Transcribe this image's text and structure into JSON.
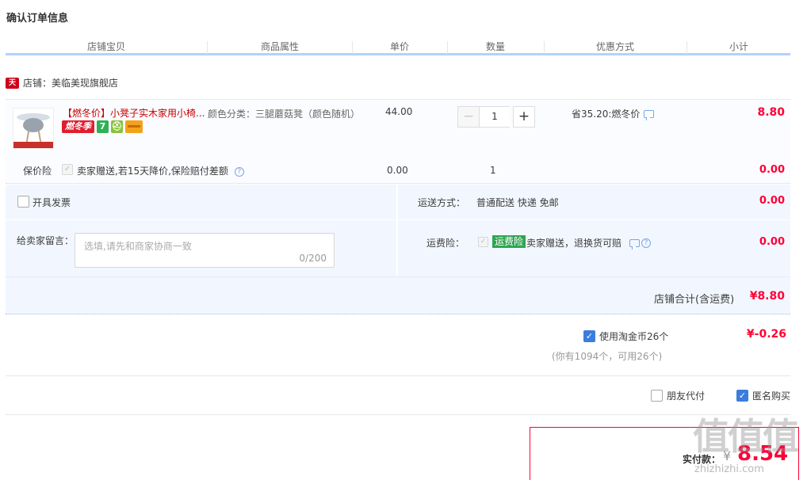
{
  "page_title": "确认订单信息",
  "columns": [
    "店铺宝贝",
    "商品属性",
    "单价",
    "数量",
    "优惠方式",
    "小计"
  ],
  "shop": {
    "badge": "天猫",
    "name": "店铺：美临美现旗舰店"
  },
  "item": {
    "thumb_caption": "三腿蘑菇凳",
    "title": "【燃冬价】小凳子实木家用小椅...",
    "promo_tag": "燃冬季",
    "promo_icons": [
      "7",
      "⛑"
    ],
    "attr": "颜色分类：三腿蘑菇凳（颜色随机）",
    "unit_price": "44.00",
    "quantity": "1",
    "minus_label": "−",
    "plus_label": "+",
    "discount": "省35.20:燃冬价",
    "subtotal": "8.80"
  },
  "insurance": {
    "label": "保价险",
    "check_mark": "✓",
    "text": "卖家赠送,若15天降价,保险赔付差额",
    "help": "?",
    "price": "0.00",
    "qty": "1",
    "subtotal": "0.00"
  },
  "invoice": {
    "label": "开具发票"
  },
  "shipping": {
    "label": "运送方式：",
    "value": "普通配送 快递 免邮",
    "fee": "0.00"
  },
  "message": {
    "label": "给卖家留言：",
    "placeholder": "选填,请先和商家协商一致",
    "counter": "0/200"
  },
  "freight_insurance": {
    "label": "运费险：",
    "check_mark": "✓",
    "tag": "运费险",
    "text": "卖家赠送，退换货可赔",
    "help": "?",
    "fee": "0.00"
  },
  "shop_total": {
    "label": "店铺合计(含运费)",
    "value": "¥8.80"
  },
  "coins": {
    "check_mark": "✓",
    "label": "使用淘金币26个",
    "value": "¥-0.26",
    "note": "(你有1094个，可用26个)"
  },
  "friend_pay": {
    "label": "朋友代付"
  },
  "anonymous": {
    "check_mark": "✓",
    "label": "匿名购买"
  },
  "payment": {
    "label": "实付款：",
    "currency": "¥",
    "value": "8.54"
  },
  "watermark": {
    "big": "值值值",
    "small": "zhizhizhi.com"
  },
  "colors": {
    "price_red": "#ff0036",
    "accent_blue": "#3b7ddd",
    "header_line": "#b2d1ff",
    "panel_bg": "#f2f7ff"
  }
}
